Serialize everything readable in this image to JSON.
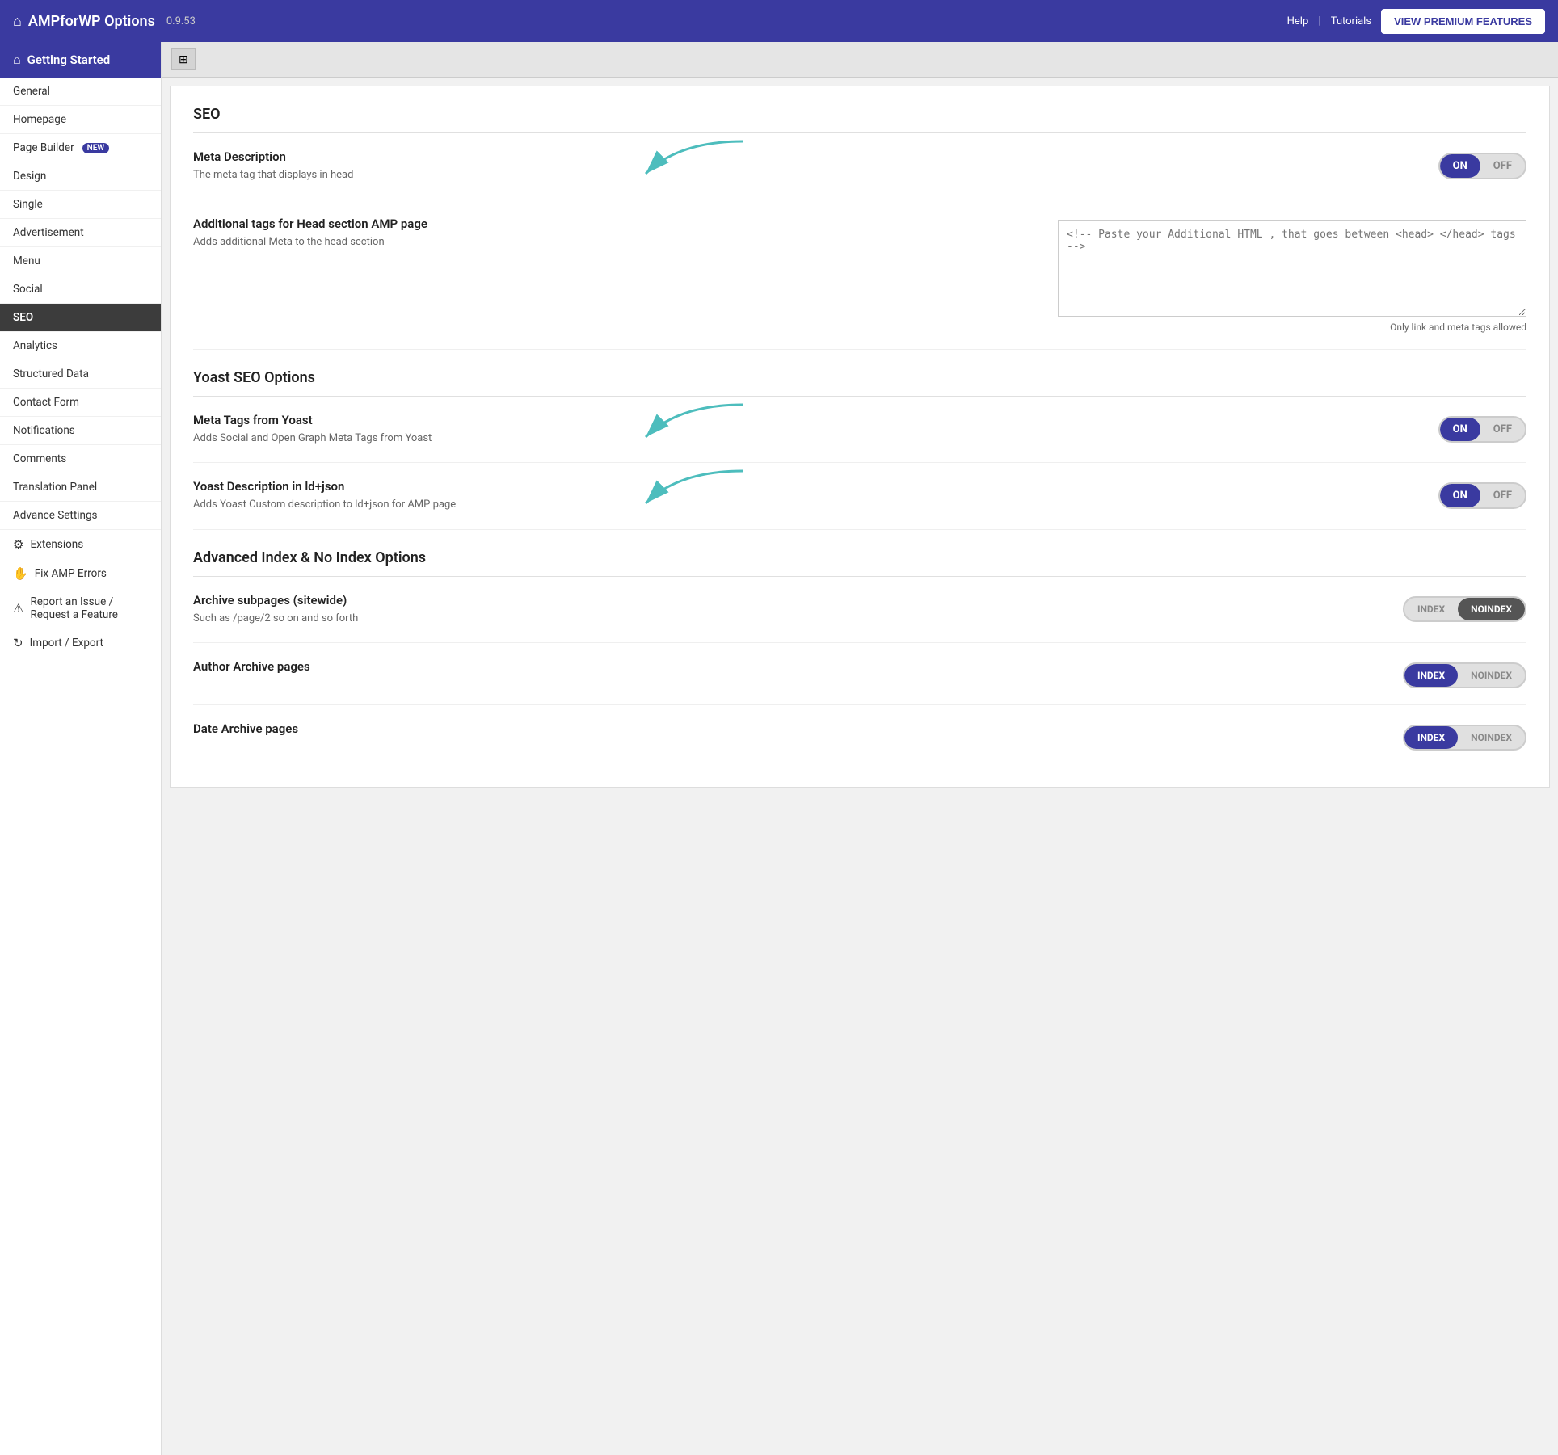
{
  "header": {
    "title": "AMPforWP Options",
    "version": "0.9.53",
    "help_label": "Help",
    "tutorials_label": "Tutorials",
    "premium_btn": "VIEW PREMIUM FEATURES"
  },
  "sidebar": {
    "getting_started": "Getting Started",
    "items": [
      {
        "label": "General",
        "id": "general"
      },
      {
        "label": "Homepage",
        "id": "homepage"
      },
      {
        "label": "Page Builder",
        "id": "page-builder",
        "badge": "NEW"
      },
      {
        "label": "Design",
        "id": "design"
      },
      {
        "label": "Single",
        "id": "single"
      },
      {
        "label": "Advertisement",
        "id": "advertisement"
      },
      {
        "label": "Menu",
        "id": "menu"
      },
      {
        "label": "Social",
        "id": "social"
      },
      {
        "label": "SEO",
        "id": "seo",
        "active": true
      },
      {
        "label": "Analytics",
        "id": "analytics"
      },
      {
        "label": "Structured Data",
        "id": "structured-data"
      },
      {
        "label": "Contact Form",
        "id": "contact-form"
      },
      {
        "label": "Notifications",
        "id": "notifications"
      },
      {
        "label": "Comments",
        "id": "comments"
      },
      {
        "label": "Translation Panel",
        "id": "translation-panel"
      },
      {
        "label": "Advance Settings",
        "id": "advance-settings"
      }
    ],
    "extensions": "Extensions",
    "fix_amp_errors": "Fix AMP Errors",
    "report_issue": "Report an Issue / Request a Feature",
    "import_export": "Import / Export"
  },
  "main": {
    "seo_section_title": "SEO",
    "meta_description_label": "Meta Description",
    "meta_description_desc": "The meta tag that displays in head",
    "meta_description_on": "ON",
    "meta_description_off": "OFF",
    "additional_tags_label": "Additional tags for Head section AMP page",
    "additional_tags_desc": "Adds additional Meta to the head section",
    "additional_tags_placeholder": "<!-- Paste your Additional HTML , that goes between <head> </head> tags -->",
    "additional_tags_note": "Only link and meta tags allowed",
    "yoast_section_title": "Yoast SEO Options",
    "meta_tags_yoast_label": "Meta Tags from Yoast",
    "meta_tags_yoast_desc": "Adds Social and Open Graph Meta Tags from Yoast",
    "meta_tags_yoast_on": "ON",
    "meta_tags_yoast_off": "OFF",
    "yoast_desc_label": "Yoast Description in ld+json",
    "yoast_desc_desc": "Adds Yoast Custom description to ld+json for AMP page",
    "yoast_desc_on": "ON",
    "yoast_desc_off": "OFF",
    "advanced_section_title": "Advanced Index & No Index Options",
    "archive_label": "Archive subpages (sitewide)",
    "archive_desc": "Such as /page/2 so on and so forth",
    "archive_index": "INDEX",
    "archive_noindex": "NOINDEX",
    "author_archive_label": "Author Archive pages",
    "author_index": "INDEX",
    "author_noindex": "NOINDEX",
    "date_archive_label": "Date Archive pages",
    "date_index": "INDEX",
    "date_noindex": "NOINDEX"
  }
}
